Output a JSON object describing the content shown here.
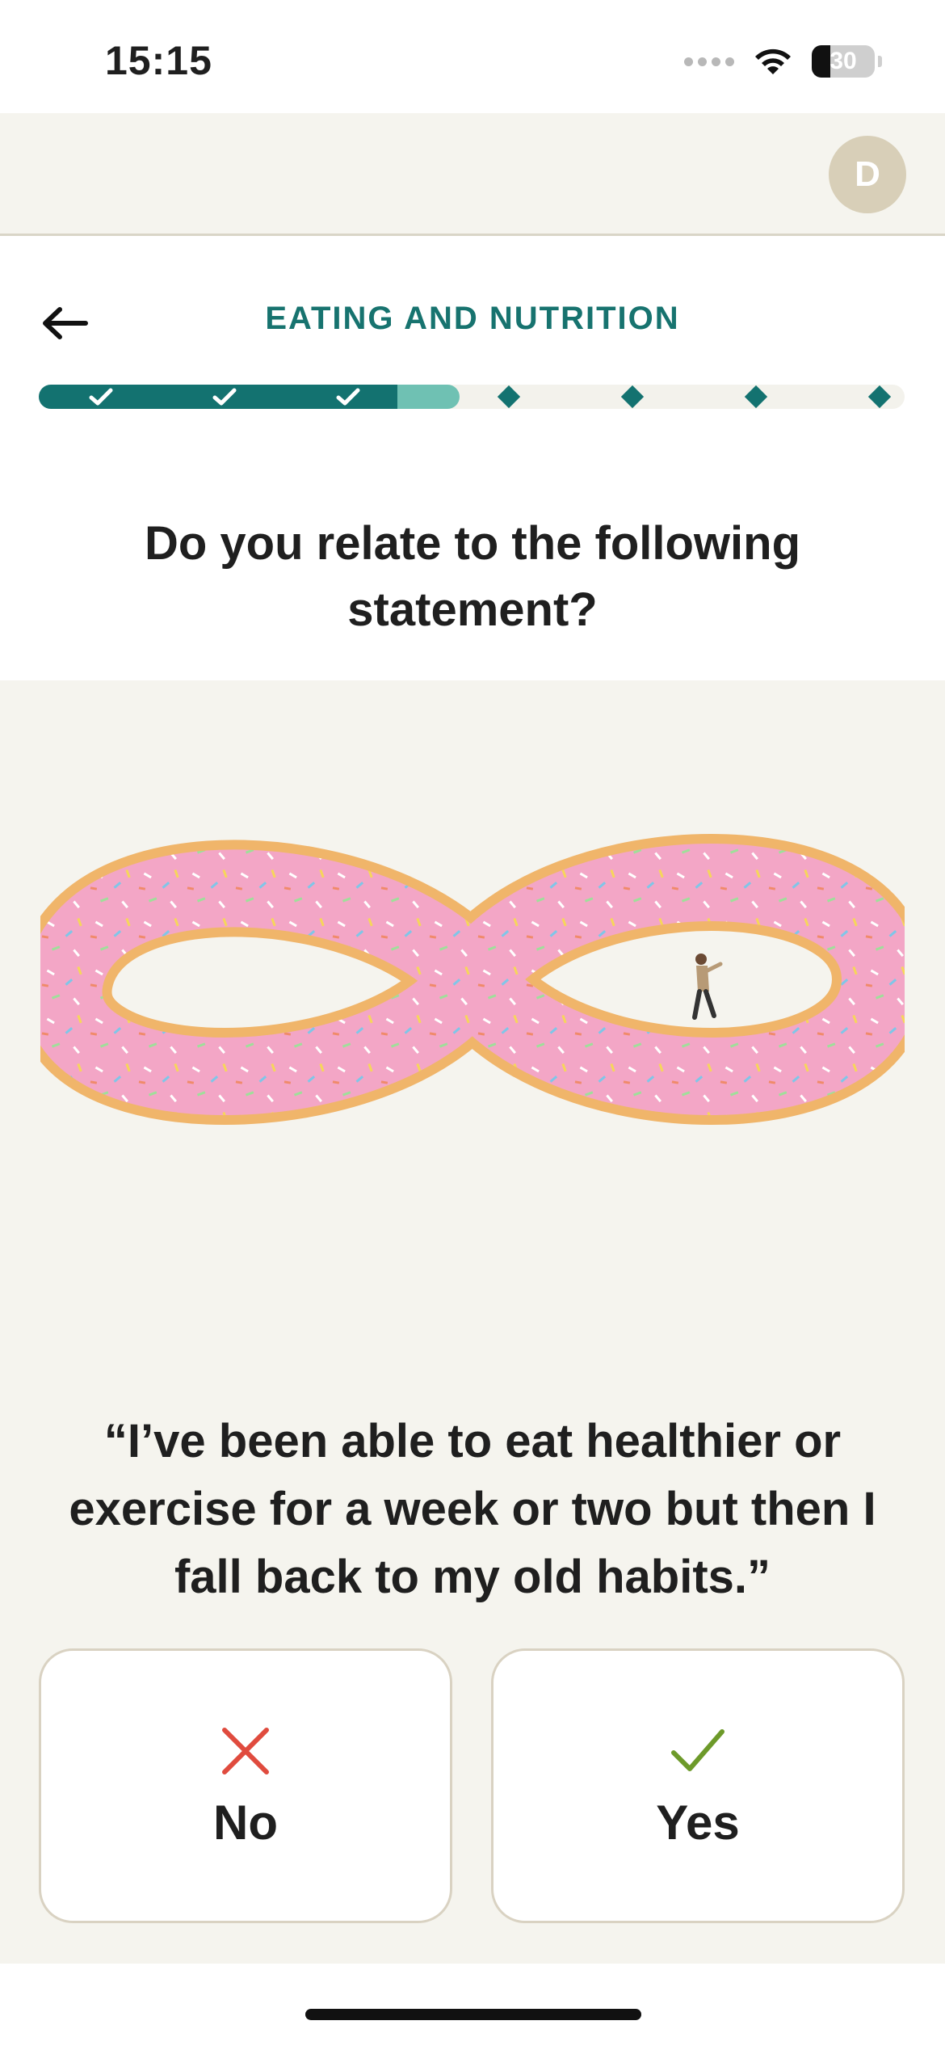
{
  "status_bar": {
    "time": "15:15",
    "battery": "30",
    "battery_level": 0.3,
    "icons": [
      "signal-dots-icon",
      "wifi-icon",
      "battery-icon"
    ]
  },
  "header": {
    "avatar_initial": "D"
  },
  "section": {
    "title": "EATING AND NUTRITION",
    "back_icon": "arrow-left-icon"
  },
  "progress": {
    "completed_steps": 3,
    "total_steps": 7,
    "current_step_progress": 0.4,
    "accent": "#137270"
  },
  "question": {
    "text": "Do you relate to the following statement?"
  },
  "illustration": {
    "icon": "donut-infinity-illustration"
  },
  "statement": {
    "text": "“I’ve been able to eat healthier or exercise for a week or two but then I fall back to my old habits.”"
  },
  "answers": {
    "no": {
      "label": "No",
      "icon": "x-icon",
      "color": "#e04b3e"
    },
    "yes": {
      "label": "Yes",
      "icon": "check-icon",
      "color": "#6d9a2a"
    }
  },
  "colors": {
    "background": "#f5f4ee",
    "teal": "#137270",
    "teal_light": "#6fc1b3"
  }
}
